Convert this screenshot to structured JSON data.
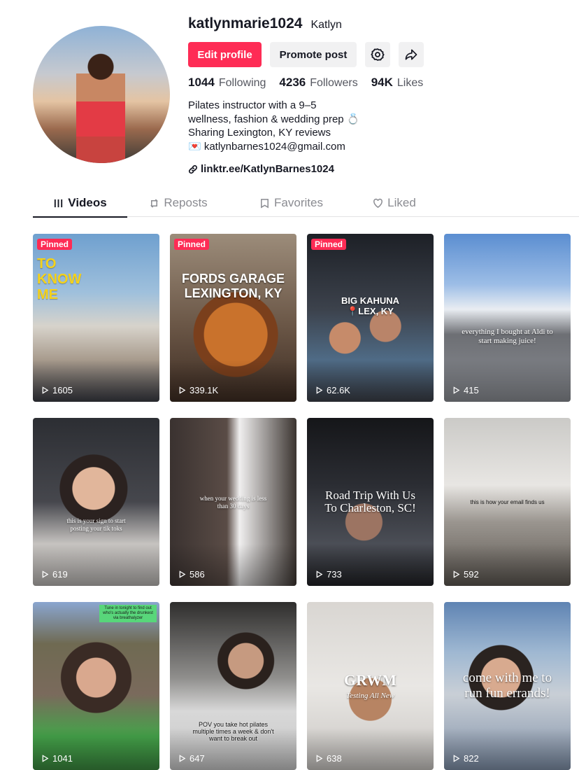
{
  "profile": {
    "handle": "katlynmarie1024",
    "display_name": "Katlyn",
    "buttons": {
      "edit_profile": "Edit profile",
      "promote_post": "Promote post"
    },
    "stats": [
      {
        "num": "1044",
        "label": "Following"
      },
      {
        "num": "4236",
        "label": "Followers"
      },
      {
        "num": "94K",
        "label": "Likes"
      }
    ],
    "bio": [
      "Pilates instructor with a 9–5",
      "wellness, fashion & wedding prep 💍",
      "Sharing Lexington, KY reviews",
      "💌 katlynbarnes1024@gmail.com"
    ],
    "link": "linktr.ee/KatlynBarnes1024"
  },
  "tabs": [
    {
      "label": "Videos",
      "icon": "grid-icon"
    },
    {
      "label": "Reposts",
      "icon": "repost-icon"
    },
    {
      "label": "Favorites",
      "icon": "bookmark-icon"
    },
    {
      "label": "Liked",
      "icon": "heart-icon"
    }
  ],
  "videos": [
    {
      "pinned": "Pinned",
      "views": "1605",
      "overlay": "TO KNOW ME"
    },
    {
      "pinned": "Pinned",
      "views": "339.1K",
      "overlay": "FORDS GARAGE LEXINGTON, KY"
    },
    {
      "pinned": "Pinned",
      "views": "62.6K",
      "overlay": "BIG KAHUNA 📍LEX, KY"
    },
    {
      "views": "415",
      "overlay": "everything I bought at Aldi to start making juice!"
    },
    {
      "views": "619",
      "overlay": "this is your sign to start posting your tik toks"
    },
    {
      "views": "586",
      "overlay": "when your wedding is less than 30 days"
    },
    {
      "views": "733",
      "overlay": "Road Trip With Us To Charleston, SC!"
    },
    {
      "views": "592",
      "overlay": "this is how your email finds us"
    },
    {
      "views": "1041",
      "overlay": "Tune in tonight to find out who's actually the drunkest via breathalyzer"
    },
    {
      "views": "647",
      "overlay": "POV you take hot pilates multiple times a week & don't want to break out"
    },
    {
      "views": "638",
      "overlay": "GRWM",
      "overlay_sub": "Testing All New"
    },
    {
      "views": "822",
      "overlay": "come with me to run fun errands!"
    }
  ],
  "colors": {
    "accent": "#fe2c55",
    "text": "#161823",
    "muted": "#8a8b91"
  }
}
